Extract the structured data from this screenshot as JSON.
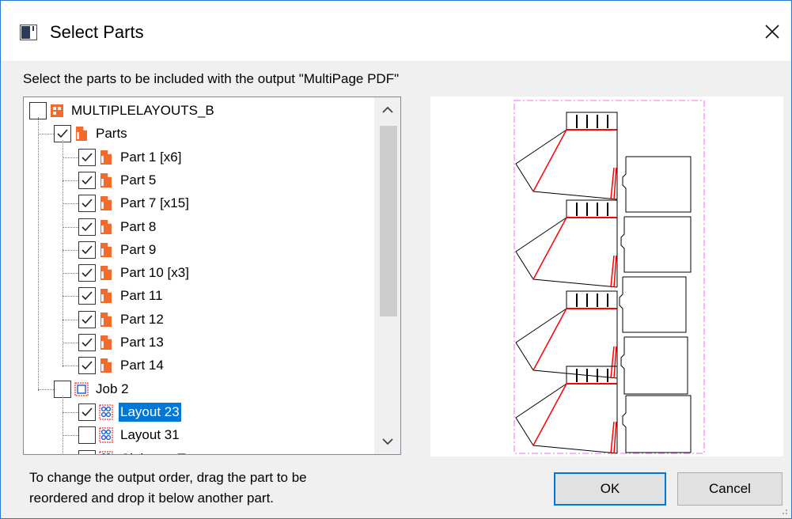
{
  "dialog": {
    "title": "Select Parts",
    "close_symbol": "✕",
    "instruction": "Select the parts to be included with the output \"MultiPage PDF\"",
    "hint_line1": "To change the output order, drag the part to be",
    "hint_line2": "reordered and drop it below another part.",
    "ok_label": "OK",
    "cancel_label": "Cancel"
  },
  "tree": {
    "items": [
      {
        "label": "MULTIPLELAYOUTS_B",
        "level": 0,
        "checked": false,
        "icon": "job-icon"
      },
      {
        "label": "Parts",
        "level": 1,
        "checked": true,
        "icon": "parts-folder-icon"
      },
      {
        "label": "Part 1 [x6]",
        "level": 2,
        "checked": true,
        "icon": "part-icon"
      },
      {
        "label": "Part 5",
        "level": 2,
        "checked": true,
        "icon": "part-icon"
      },
      {
        "label": "Part 7 [x15]",
        "level": 2,
        "checked": true,
        "icon": "part-icon"
      },
      {
        "label": "Part 8",
        "level": 2,
        "checked": true,
        "icon": "part-icon"
      },
      {
        "label": "Part 9",
        "level": 2,
        "checked": true,
        "icon": "part-icon"
      },
      {
        "label": "Part 10 [x3]",
        "level": 2,
        "checked": true,
        "icon": "part-icon"
      },
      {
        "label": "Part 11",
        "level": 2,
        "checked": true,
        "icon": "part-icon"
      },
      {
        "label": "Part 12",
        "level": 2,
        "checked": true,
        "icon": "part-icon"
      },
      {
        "label": "Part 13",
        "level": 2,
        "checked": true,
        "icon": "part-icon"
      },
      {
        "label": "Part 14",
        "level": 2,
        "checked": true,
        "icon": "part-icon"
      },
      {
        "label": "Job 2",
        "level": 1,
        "checked": false,
        "icon": "sheet-icon"
      },
      {
        "label": "Layout 23",
        "level": 2,
        "checked": true,
        "icon": "layout-icon",
        "selected": true
      },
      {
        "label": "Layout 31",
        "level": 2,
        "checked": false,
        "icon": "layout-icon"
      },
      {
        "label": "Clairman Town",
        "level": 2,
        "checked": false,
        "icon": "layout-icon"
      }
    ]
  },
  "colors": {
    "accent": "#0078d7",
    "part_orange": "#f26b2a",
    "layout_blue": "#1a5bd6",
    "preview_border": "#ff66ff",
    "cut_red": "#ff0000"
  }
}
